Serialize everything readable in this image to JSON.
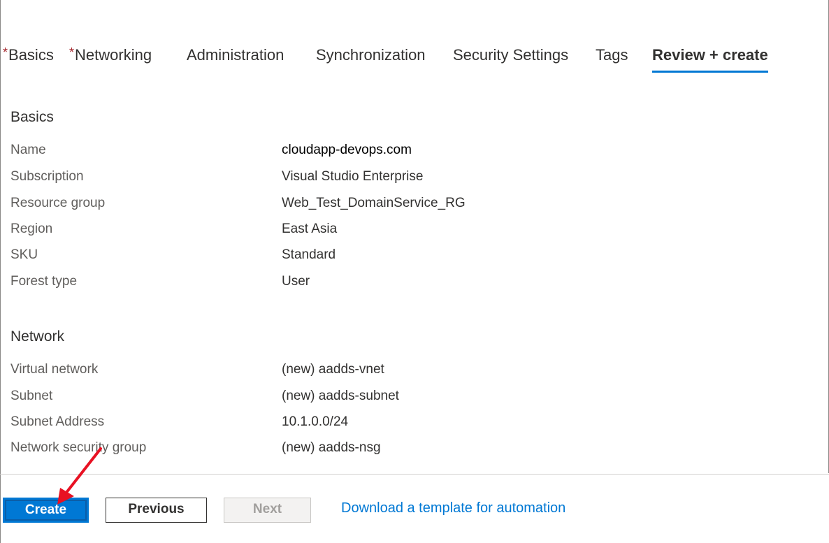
{
  "tabs": [
    {
      "label": "Basics",
      "required": "*"
    },
    {
      "label": "Networking",
      "required": "*"
    },
    {
      "label": "Administration",
      "required": ""
    },
    {
      "label": "Synchronization",
      "required": ""
    },
    {
      "label": "Security Settings",
      "required": ""
    },
    {
      "label": "Tags",
      "required": ""
    },
    {
      "label": "Review + create",
      "required": "",
      "active": true
    }
  ],
  "basics": {
    "title": "Basics",
    "rows": [
      {
        "label": "Name",
        "value": "cloudapp-devops.com"
      },
      {
        "label": "Subscription",
        "value": "Visual Studio Enterprise"
      },
      {
        "label": "Resource group",
        "value": "Web_Test_DomainService_RG"
      },
      {
        "label": "Region",
        "value": "East Asia"
      },
      {
        "label": "SKU",
        "value": "Standard"
      },
      {
        "label": "Forest type",
        "value": "User"
      }
    ]
  },
  "network": {
    "title": "Network",
    "rows": [
      {
        "label": "Virtual network",
        "value": "(new) aadds-vnet"
      },
      {
        "label": "Subnet",
        "value": "(new) aadds-subnet"
      },
      {
        "label": "Subnet Address",
        "value": "10.1.0.0/24"
      },
      {
        "label": "Network security group",
        "value": "(new) aadds-nsg"
      }
    ]
  },
  "footer": {
    "create_label": "Create",
    "previous_label": "Previous",
    "next_label": "Next",
    "template_link": "Download a template for automation"
  },
  "colors": {
    "accent": "#0078d4",
    "required": "#a4262c",
    "annotation_arrow": "#e81123"
  }
}
